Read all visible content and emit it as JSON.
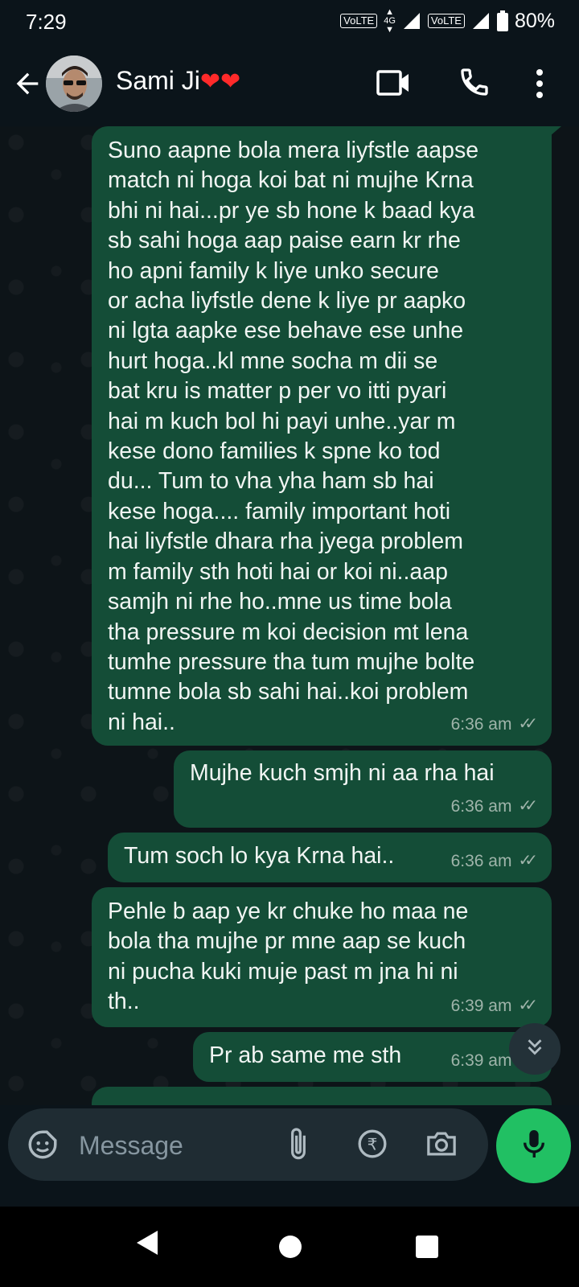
{
  "status_bar": {
    "time": "7:29",
    "volte_1": "VoLTE",
    "network_type": "4G",
    "volte_2": "VoLTE",
    "battery": "80%"
  },
  "header": {
    "contact_name": "Sami Ji",
    "name_emoji": "❤❤"
  },
  "messages": [
    {
      "text": "Suno aapne bola mera liyfstle aapse\nmatch ni hoga koi bat ni mujhe Krna\nbhi ni hai...pr ye sb hone k baad kya\nsb sahi hoga aap paise earn kr rhe\nho apni family k liye unko secure\nor acha liyfstle dene k liye pr aapko\nni lgta aapke ese behave ese unhe\nhurt hoga..kl mne socha m dii se\nbat kru is matter p per vo itti pyari\nhai m kuch bol hi payi unhe..yar m\nkese dono families k spne ko tod\ndu... Tum to vha yha ham sb hai\nkese hoga.... family important hoti\nhai liyfstle dhara rha jyega problem\nm family sth hoti hai or koi ni..aap\nsamjh ni rhe ho..mne us time bola\ntha pressure m koi decision mt lena\ntumhe pressure tha tum mujhe bolte\ntumne bola sb sahi hai..koi problem\nni hai..",
      "time": "6:36 am"
    },
    {
      "text": "Mujhe kuch smjh ni aa rha hai",
      "time": "6:36 am"
    },
    {
      "text": "Tum soch lo kya Krna hai..",
      "time": "6:36 am"
    },
    {
      "text": "Pehle b aap ye kr chuke ho maa ne\nbola tha mujhe pr mne aap se kuch\nni pucha kuki muje past m jna hi ni\nth..",
      "time": "6:39 am"
    },
    {
      "text": "Pr ab same me sth",
      "time": "6:39 am"
    }
  ],
  "input": {
    "placeholder": "Message"
  },
  "icons": {
    "back": "arrow-left-icon",
    "video": "video-camera-icon",
    "call": "phone-icon",
    "more": "more-vertical-icon",
    "sticker": "sticker-icon",
    "attach": "paperclip-icon",
    "payment": "rupee-icon",
    "camera": "camera-icon",
    "mic": "microphone-icon",
    "scroll_down": "double-chevron-down-icon"
  },
  "colors": {
    "background": "#0b141a",
    "outgoing_bubble": "#144d37",
    "mic_button": "#21c063",
    "heart": "#ff2a2a"
  }
}
